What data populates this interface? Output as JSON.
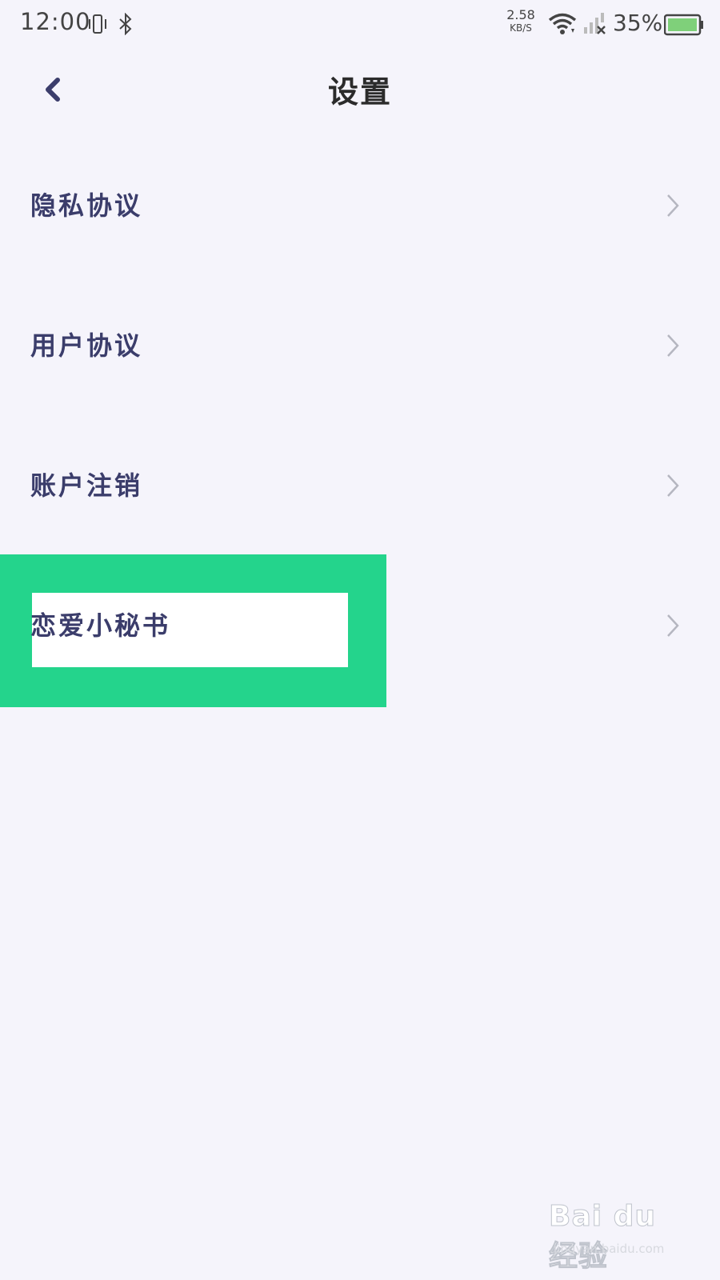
{
  "status_bar": {
    "time": "12:00",
    "net_speed_value": "2.58",
    "net_speed_unit": "KB/S",
    "battery_percent": "35%",
    "icons": [
      "vibrate-icon",
      "bluetooth-icon",
      "wifi-icon",
      "signal-icon",
      "battery-icon"
    ]
  },
  "header": {
    "title": "设置",
    "back_icon": "chevron-left-icon"
  },
  "menu": {
    "items": [
      {
        "label": "隐私协议"
      },
      {
        "label": "用户协议"
      },
      {
        "label": "账户注销"
      },
      {
        "label": "恋爱小秘书"
      }
    ],
    "chevron_icon": "chevron-right-icon"
  },
  "watermark": {
    "brand": "Bai du 经验",
    "url": "jingyan.baidu.com"
  },
  "colors": {
    "background": "#f5f4fb",
    "label": "#3b3d6b",
    "highlight": "#24d48c",
    "battery_fill": "#7fd07a"
  }
}
